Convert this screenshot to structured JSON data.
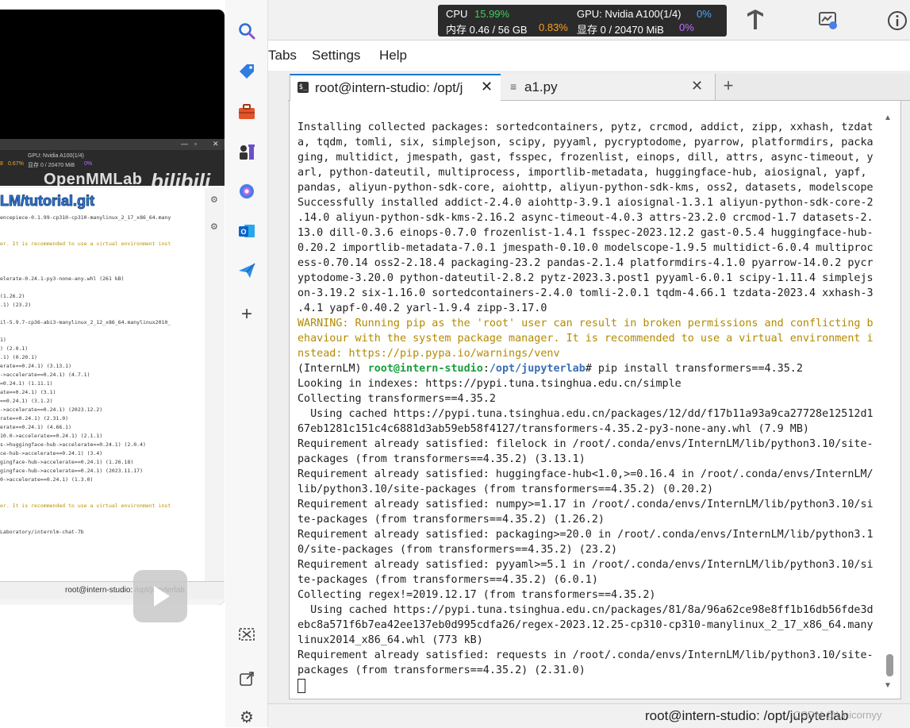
{
  "video": {
    "logo_openmmlab": "OpenMMLab",
    "logo_bili": "bilibili",
    "mini_gpu": "GPU: Nvidia A100(1/4)",
    "mini_mem": "显存 0 / 20470 MiB",
    "mini_pct1": "8",
    "mini_pct2": "0.67%",
    "mini_pct3": "0%",
    "git_text": "LM/tutorial.git",
    "lines": [
      {
        "t": "encepiece-0.1.99-cp310-cp310-manylinux_2_17_x86_64.many",
        "c": ""
      },
      {
        "t": "",
        "c": ""
      },
      {
        "t": "",
        "c": ""
      },
      {
        "t": "er. It is recommended to use a virtual environment inst",
        "c": "warn"
      },
      {
        "t": "",
        "c": ""
      },
      {
        "t": "",
        "c": ""
      },
      {
        "t": "",
        "c": ""
      },
      {
        "t": "elerate-0.24.1-py3-none-any.whl (261 kB)",
        "c": ""
      },
      {
        "t": "",
        "c": ""
      },
      {
        "t": "(1.26.2)",
        "c": ""
      },
      {
        "t": ".1) (23.2)",
        "c": ""
      },
      {
        "t": "",
        "c": ""
      },
      {
        "t": "il-5.9.7-cp36-abi3-manylinux_2_12_x86_64.manylinux2010_",
        "c": ""
      },
      {
        "t": "",
        "c": ""
      },
      {
        "t": "1)",
        "c": ""
      },
      {
        "t": ") (2.0.1)",
        "c": ""
      },
      {
        "t": ".1) (0.20.1)",
        "c": ""
      },
      {
        "t": "erate==0.24.1) (3.13.1)",
        "c": ""
      },
      {
        "t": "->accelerate==0.24.1) (4.7.1)",
        "c": ""
      },
      {
        "t": "=0.24.1) (1.11.1)",
        "c": ""
      },
      {
        "t": "ate==0.24.1) (3.1)",
        "c": ""
      },
      {
        "t": "==0.24.1) (3.1.2)",
        "c": ""
      },
      {
        "t": "->accelerate==0.24.1) (2023.12.2)",
        "c": ""
      },
      {
        "t": "rate==0.24.1) (2.31.0)",
        "c": ""
      },
      {
        "t": "erate==0.24.1) (4.66.1)",
        "c": ""
      },
      {
        "t": "10.0->accelerate==0.24.1) (2.1.1)",
        "c": ""
      },
      {
        "t": "s->huggingface-hub->accelerate==0.24.1) (2.0.4)",
        "c": ""
      },
      {
        "t": "ce-hub->accelerate==0.24.1) (3.4)",
        "c": ""
      },
      {
        "t": "gingface-hub->accelerate==0.24.1) (1.26.18)",
        "c": ""
      },
      {
        "t": "gingface-hub->accelerate==0.24.1) (2023.11.17)",
        "c": ""
      },
      {
        "t": "0->accelerate==0.24.1) (1.3.0)",
        "c": ""
      },
      {
        "t": "",
        "c": ""
      },
      {
        "t": "",
        "c": ""
      },
      {
        "t": "er. It is recommended to use a virtual environment inst",
        "c": "warn"
      },
      {
        "t": "",
        "c": ""
      },
      {
        "t": "",
        "c": ""
      },
      {
        "t": "Laboratory/internlm-chat-7b",
        "c": ""
      }
    ],
    "status": "root@intern-studio: /opt/jupyterlab"
  },
  "edge_sidebar": {
    "icons": [
      "search-icon",
      "tag-icon",
      "toolbox-icon",
      "chess-icon",
      "copilot-icon",
      "outlook-icon",
      "send-icon",
      "add-icon",
      "screenshot-icon",
      "external-link-icon",
      "settings-icon"
    ]
  },
  "topbar": {
    "cpu_label": "CPU",
    "cpu_pct": "15.99%",
    "mem_label": "内存 0.46 / 56 GB",
    "mem_pct": "0.83%",
    "gpu_label": "GPU: Nvidia A100(1/4)",
    "gpu_pct": "0%",
    "vram_label": "显存 0 / 20470 MiB",
    "vram_pct": "0%",
    "colors": {
      "cpu": "#3ccf5c",
      "mem": "#ff9f1a",
      "gpu": "#4ea3ff",
      "vram": "#c06bff"
    }
  },
  "menu": {
    "tabs": "Tabs",
    "settings": "Settings",
    "help": "Help"
  },
  "tabs": {
    "terminal": "root@intern-studio: /opt/j",
    "file": "a1.py",
    "add": "+"
  },
  "terminal_lines": [
    [
      {
        "t": "Installing collected packages: sortedcontainers, pytz, crcmod, addict, zipp, xxhash, tzdat",
        "c": ""
      }
    ],
    [
      {
        "t": "a, tqdm, tomli, six, simplejson, scipy, pyyaml, pycryptodome, pyarrow, platformdirs, packa",
        "c": ""
      }
    ],
    [
      {
        "t": "ging, multidict, jmespath, gast, fsspec, frozenlist, einops, dill, attrs, async-timeout, y",
        "c": ""
      }
    ],
    [
      {
        "t": "arl, python-dateutil, multiprocess, importlib-metadata, huggingface-hub, aiosignal, yapf,",
        "c": ""
      }
    ],
    [
      {
        "t": "pandas, aliyun-python-sdk-core, aiohttp, aliyun-python-sdk-kms, oss2, datasets, modelscope",
        "c": ""
      }
    ],
    [
      {
        "t": "Successfully installed addict-2.4.0 aiohttp-3.9.1 aiosignal-1.3.1 aliyun-python-sdk-core-2",
        "c": ""
      }
    ],
    [
      {
        "t": ".14.0 aliyun-python-sdk-kms-2.16.2 async-timeout-4.0.3 attrs-23.2.0 crcmod-1.7 datasets-2.",
        "c": ""
      }
    ],
    [
      {
        "t": "13.0 dill-0.3.6 einops-0.7.0 frozenlist-1.4.1 fsspec-2023.12.2 gast-0.5.4 huggingface-hub-",
        "c": ""
      }
    ],
    [
      {
        "t": "0.20.2 importlib-metadata-7.0.1 jmespath-0.10.0 modelscope-1.9.5 multidict-6.0.4 multiproc",
        "c": ""
      }
    ],
    [
      {
        "t": "ess-0.70.14 oss2-2.18.4 packaging-23.2 pandas-2.1.4 platformdirs-4.1.0 pyarrow-14.0.2 pycr",
        "c": ""
      }
    ],
    [
      {
        "t": "yptodome-3.20.0 python-dateutil-2.8.2 pytz-2023.3.post1 pyyaml-6.0.1 scipy-1.11.4 simplejs",
        "c": ""
      }
    ],
    [
      {
        "t": "on-3.19.2 six-1.16.0 sortedcontainers-2.4.0 tomli-2.0.1 tqdm-4.66.1 tzdata-2023.4 xxhash-3",
        "c": ""
      }
    ],
    [
      {
        "t": ".4.1 yapf-0.40.2 yarl-1.9.4 zipp-3.17.0",
        "c": ""
      }
    ],
    [
      {
        "t": "WARNING: Running pip as the 'root' user can result in broken permissions and conflicting b",
        "c": "y"
      }
    ],
    [
      {
        "t": "ehaviour with the system package manager. It is recommended to use a virtual environment i",
        "c": "y"
      }
    ],
    [
      {
        "t": "nstead: https://pip.pypa.io/warnings/venv",
        "c": "y"
      }
    ],
    [
      {
        "t": "(InternLM) ",
        "c": ""
      },
      {
        "t": "root@intern-studio",
        "c": "g"
      },
      {
        "t": ":",
        "c": ""
      },
      {
        "t": "/opt/jupyterlab",
        "c": "b"
      },
      {
        "t": "# pip install transformers==4.35.2",
        "c": ""
      }
    ],
    [
      {
        "t": "Looking in indexes: https://pypi.tuna.tsinghua.edu.cn/simple",
        "c": ""
      }
    ],
    [
      {
        "t": "Collecting transformers==4.35.2",
        "c": ""
      }
    ],
    [
      {
        "t": "  Using cached https://pypi.tuna.tsinghua.edu.cn/packages/12/dd/f17b11a93a9ca27728e12512d1",
        "c": ""
      }
    ],
    [
      {
        "t": "67eb1281c151c4c6881d3ab59eb58f4127/transformers-4.35.2-py3-none-any.whl (7.9 MB)",
        "c": ""
      }
    ],
    [
      {
        "t": "Requirement already satisfied: filelock in /root/.conda/envs/InternLM/lib/python3.10/site-",
        "c": ""
      }
    ],
    [
      {
        "t": "packages (from transformers==4.35.2) (3.13.1)",
        "c": ""
      }
    ],
    [
      {
        "t": "Requirement already satisfied: huggingface-hub<1.0,>=0.16.4 in /root/.conda/envs/InternLM/",
        "c": ""
      }
    ],
    [
      {
        "t": "lib/python3.10/site-packages (from transformers==4.35.2) (0.20.2)",
        "c": ""
      }
    ],
    [
      {
        "t": "Requirement already satisfied: numpy>=1.17 in /root/.conda/envs/InternLM/lib/python3.10/si",
        "c": ""
      }
    ],
    [
      {
        "t": "te-packages (from transformers==4.35.2) (1.26.2)",
        "c": ""
      }
    ],
    [
      {
        "t": "Requirement already satisfied: packaging>=20.0 in /root/.conda/envs/InternLM/lib/python3.1",
        "c": ""
      }
    ],
    [
      {
        "t": "0/site-packages (from transformers==4.35.2) (23.2)",
        "c": ""
      }
    ],
    [
      {
        "t": "Requirement already satisfied: pyyaml>=5.1 in /root/.conda/envs/InternLM/lib/python3.10/si",
        "c": ""
      }
    ],
    [
      {
        "t": "te-packages (from transformers==4.35.2) (6.0.1)",
        "c": ""
      }
    ],
    [
      {
        "t": "Collecting regex!=2019.12.17 (from transformers==4.35.2)",
        "c": ""
      }
    ],
    [
      {
        "t": "  Using cached https://pypi.tuna.tsinghua.edu.cn/packages/81/8a/96a62ce98e8ff1b16db56fde3d",
        "c": ""
      }
    ],
    [
      {
        "t": "ebc8a571f6b7ea42ee137eb0d995cdfa26/regex-2023.12.25-cp310-cp310-manylinux_2_17_x86_64.many",
        "c": ""
      }
    ],
    [
      {
        "t": "linux2014_x86_64.whl (773 kB)",
        "c": ""
      }
    ],
    [
      {
        "t": "Requirement already satisfied: requests in /root/.conda/envs/InternLM/lib/python3.10/site-",
        "c": ""
      }
    ],
    [
      {
        "t": "packages (from transformers==4.35.2) (2.31.0)",
        "c": ""
      }
    ]
  ],
  "statusbar": {
    "text": "root@intern-studio: /opt/jupyterlab",
    "watermark": "CSDN @Unicornyy"
  }
}
